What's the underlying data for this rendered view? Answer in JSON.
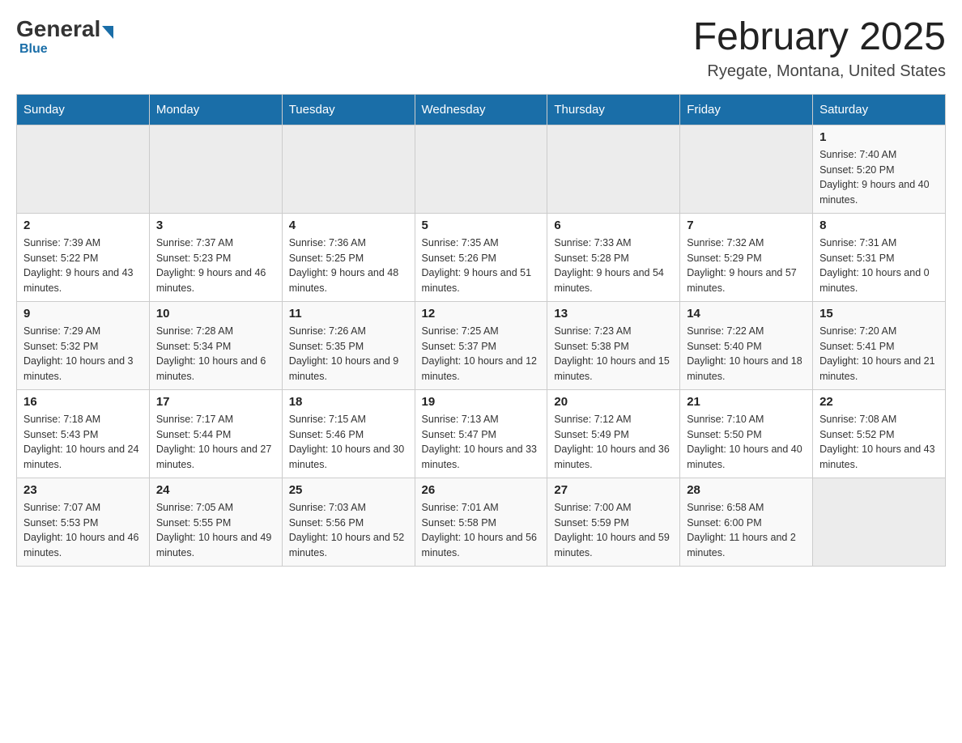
{
  "header": {
    "logo_general": "General",
    "logo_blue": "Blue",
    "month_title": "February 2025",
    "location": "Ryegate, Montana, United States"
  },
  "weekdays": [
    "Sunday",
    "Monday",
    "Tuesday",
    "Wednesday",
    "Thursday",
    "Friday",
    "Saturday"
  ],
  "rows": [
    {
      "cells": [
        {
          "empty": true
        },
        {
          "empty": true
        },
        {
          "empty": true
        },
        {
          "empty": true
        },
        {
          "empty": true
        },
        {
          "empty": true
        },
        {
          "day": 1,
          "sunrise": "7:40 AM",
          "sunset": "5:20 PM",
          "daylight": "9 hours and 40 minutes."
        }
      ]
    },
    {
      "cells": [
        {
          "day": 2,
          "sunrise": "7:39 AM",
          "sunset": "5:22 PM",
          "daylight": "9 hours and 43 minutes."
        },
        {
          "day": 3,
          "sunrise": "7:37 AM",
          "sunset": "5:23 PM",
          "daylight": "9 hours and 46 minutes."
        },
        {
          "day": 4,
          "sunrise": "7:36 AM",
          "sunset": "5:25 PM",
          "daylight": "9 hours and 48 minutes."
        },
        {
          "day": 5,
          "sunrise": "7:35 AM",
          "sunset": "5:26 PM",
          "daylight": "9 hours and 51 minutes."
        },
        {
          "day": 6,
          "sunrise": "7:33 AM",
          "sunset": "5:28 PM",
          "daylight": "9 hours and 54 minutes."
        },
        {
          "day": 7,
          "sunrise": "7:32 AM",
          "sunset": "5:29 PM",
          "daylight": "9 hours and 57 minutes."
        },
        {
          "day": 8,
          "sunrise": "7:31 AM",
          "sunset": "5:31 PM",
          "daylight": "10 hours and 0 minutes."
        }
      ]
    },
    {
      "cells": [
        {
          "day": 9,
          "sunrise": "7:29 AM",
          "sunset": "5:32 PM",
          "daylight": "10 hours and 3 minutes."
        },
        {
          "day": 10,
          "sunrise": "7:28 AM",
          "sunset": "5:34 PM",
          "daylight": "10 hours and 6 minutes."
        },
        {
          "day": 11,
          "sunrise": "7:26 AM",
          "sunset": "5:35 PM",
          "daylight": "10 hours and 9 minutes."
        },
        {
          "day": 12,
          "sunrise": "7:25 AM",
          "sunset": "5:37 PM",
          "daylight": "10 hours and 12 minutes."
        },
        {
          "day": 13,
          "sunrise": "7:23 AM",
          "sunset": "5:38 PM",
          "daylight": "10 hours and 15 minutes."
        },
        {
          "day": 14,
          "sunrise": "7:22 AM",
          "sunset": "5:40 PM",
          "daylight": "10 hours and 18 minutes."
        },
        {
          "day": 15,
          "sunrise": "7:20 AM",
          "sunset": "5:41 PM",
          "daylight": "10 hours and 21 minutes."
        }
      ]
    },
    {
      "cells": [
        {
          "day": 16,
          "sunrise": "7:18 AM",
          "sunset": "5:43 PM",
          "daylight": "10 hours and 24 minutes."
        },
        {
          "day": 17,
          "sunrise": "7:17 AM",
          "sunset": "5:44 PM",
          "daylight": "10 hours and 27 minutes."
        },
        {
          "day": 18,
          "sunrise": "7:15 AM",
          "sunset": "5:46 PM",
          "daylight": "10 hours and 30 minutes."
        },
        {
          "day": 19,
          "sunrise": "7:13 AM",
          "sunset": "5:47 PM",
          "daylight": "10 hours and 33 minutes."
        },
        {
          "day": 20,
          "sunrise": "7:12 AM",
          "sunset": "5:49 PM",
          "daylight": "10 hours and 36 minutes."
        },
        {
          "day": 21,
          "sunrise": "7:10 AM",
          "sunset": "5:50 PM",
          "daylight": "10 hours and 40 minutes."
        },
        {
          "day": 22,
          "sunrise": "7:08 AM",
          "sunset": "5:52 PM",
          "daylight": "10 hours and 43 minutes."
        }
      ]
    },
    {
      "cells": [
        {
          "day": 23,
          "sunrise": "7:07 AM",
          "sunset": "5:53 PM",
          "daylight": "10 hours and 46 minutes."
        },
        {
          "day": 24,
          "sunrise": "7:05 AM",
          "sunset": "5:55 PM",
          "daylight": "10 hours and 49 minutes."
        },
        {
          "day": 25,
          "sunrise": "7:03 AM",
          "sunset": "5:56 PM",
          "daylight": "10 hours and 52 minutes."
        },
        {
          "day": 26,
          "sunrise": "7:01 AM",
          "sunset": "5:58 PM",
          "daylight": "10 hours and 56 minutes."
        },
        {
          "day": 27,
          "sunrise": "7:00 AM",
          "sunset": "5:59 PM",
          "daylight": "10 hours and 59 minutes."
        },
        {
          "day": 28,
          "sunrise": "6:58 AM",
          "sunset": "6:00 PM",
          "daylight": "11 hours and 2 minutes."
        },
        {
          "empty": true
        }
      ]
    }
  ],
  "labels": {
    "sunrise_prefix": "Sunrise: ",
    "sunset_prefix": "Sunset: ",
    "daylight_prefix": "Daylight: "
  }
}
